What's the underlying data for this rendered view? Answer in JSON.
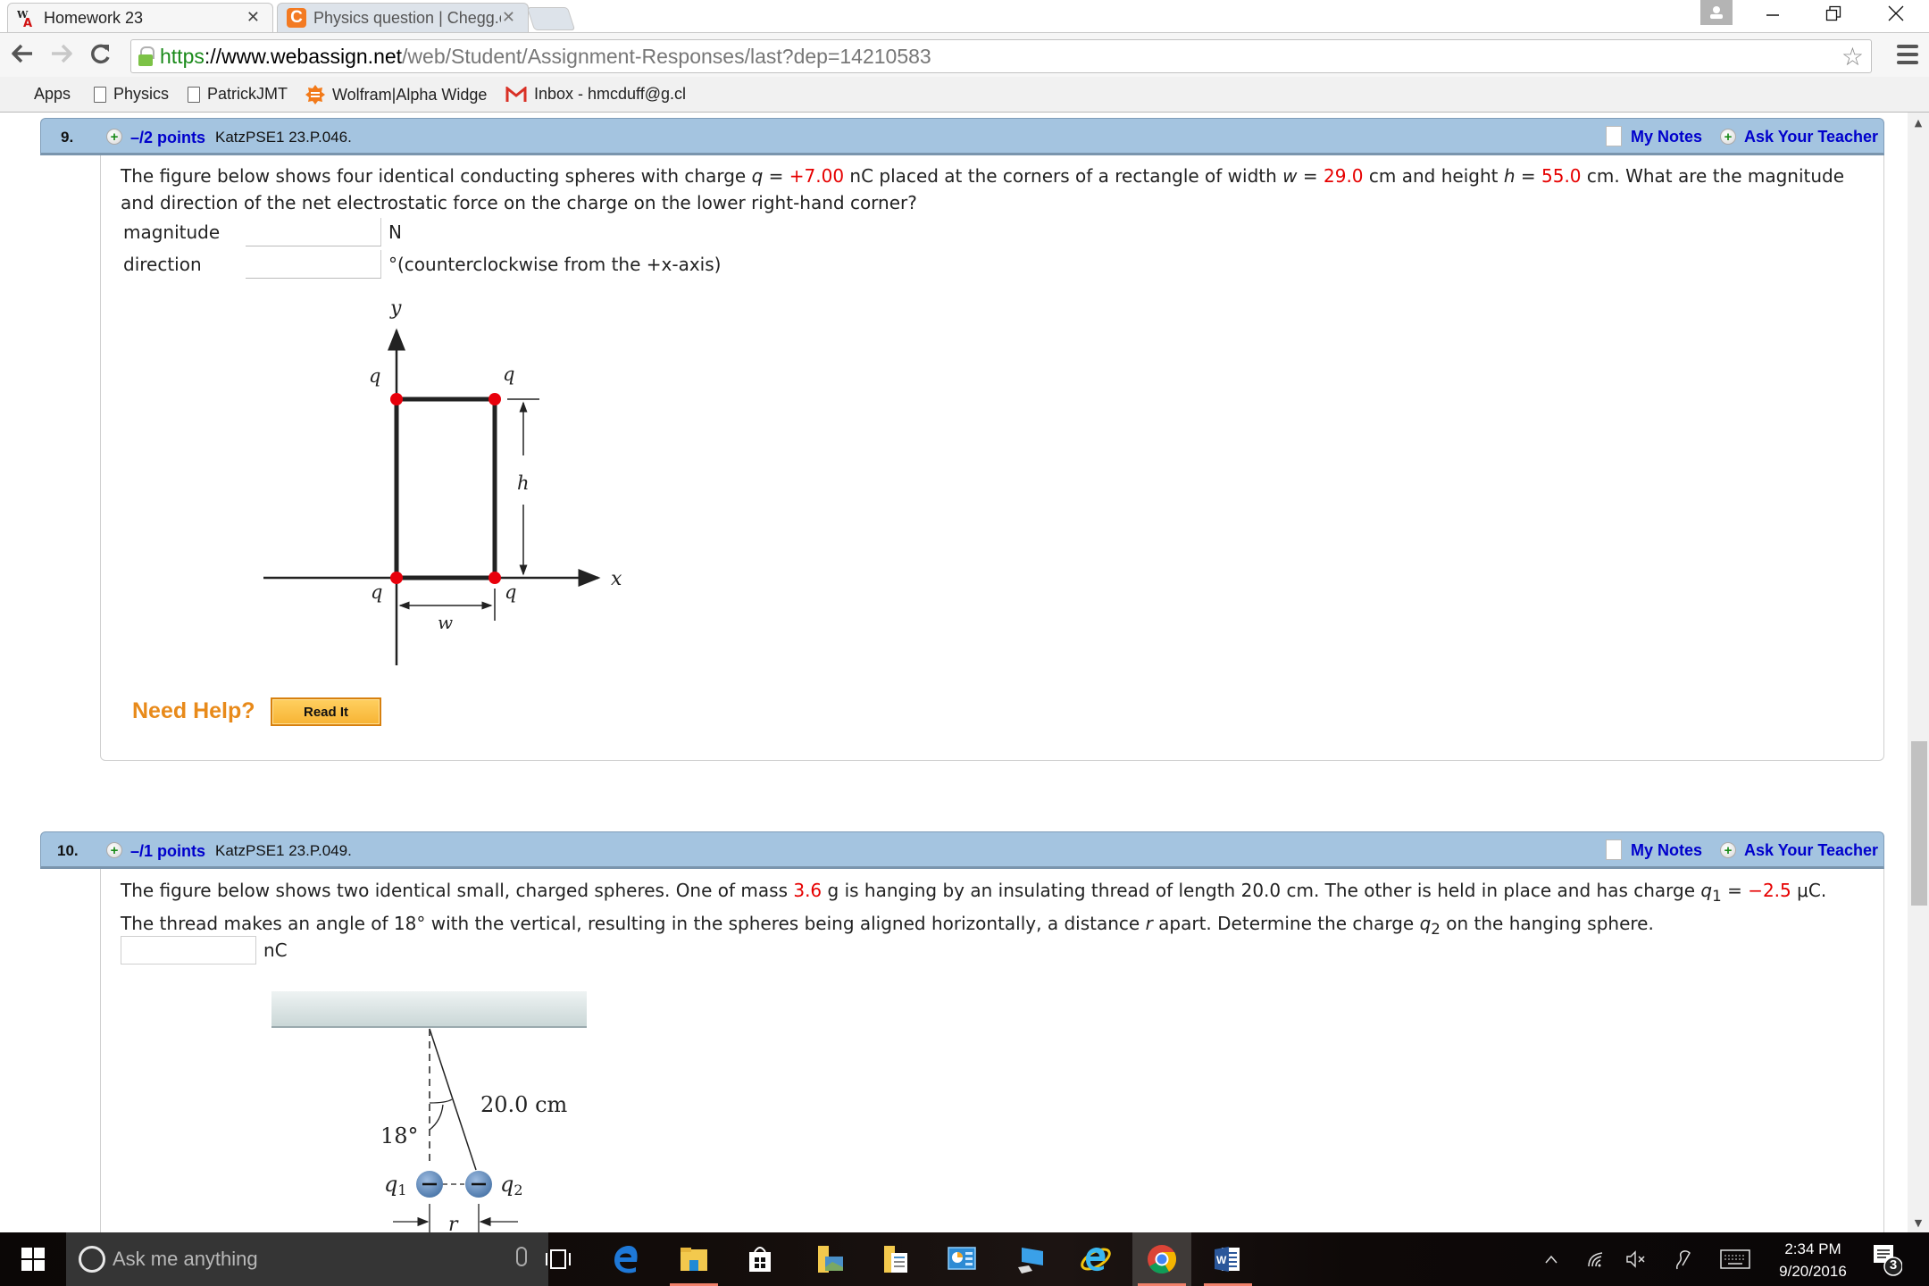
{
  "browser": {
    "tabs": [
      {
        "title": "Homework 23",
        "favicon": "webassign-icon",
        "active": true
      },
      {
        "title": "Physics question | Chegg.c",
        "favicon": "chegg-icon",
        "active": false
      }
    ],
    "url": {
      "scheme": "https",
      "host": "://www.webassign.net",
      "path": "/web/Student/Assignment-Responses/last?dep=14210583"
    },
    "bookmarks": [
      {
        "label": "Apps",
        "icon": "apps-grid-icon"
      },
      {
        "label": "Physics",
        "icon": "page-icon"
      },
      {
        "label": "PatrickJMT",
        "icon": "page-icon"
      },
      {
        "label": "Wolfram|Alpha Widge",
        "icon": "wolfram-icon"
      },
      {
        "label": "Inbox - hmcduff@g.cl",
        "icon": "gmail-icon"
      }
    ]
  },
  "questions": [
    {
      "number": "9.",
      "points": "–/2 points",
      "code": "KatzPSE1 23.P.046.",
      "my_notes": "My Notes",
      "ask_teacher": "Ask Your Teacher",
      "text": {
        "p1": "The figure below shows four identical conducting spheres with charge ",
        "q_sym": "q",
        "eq": " = ",
        "q_val": "+7.00",
        "p2": " nC  placed at the corners of a rectangle of width ",
        "w_sym": "w",
        "w_val": "29.0",
        "p3": " cm  and height ",
        "h_sym": "h",
        "h_val": "55.0",
        "p4": " cm.  What are the magnitude and direction of the net electrostatic force on the charge on the lower right-hand corner?"
      },
      "answers": [
        {
          "label": "magnitude",
          "value": "",
          "unit": "N"
        },
        {
          "label": "direction",
          "value": "",
          "unit": "°(counterclockwise from the +x-axis)"
        }
      ],
      "figure": {
        "axis_x": "x",
        "axis_y": "y",
        "charge_label": "q",
        "width_label": "w",
        "height_label": "h"
      },
      "need_help": "Need Help?",
      "read_it": "Read It"
    },
    {
      "number": "10.",
      "points": "–/1 points",
      "code": "KatzPSE1 23.P.049.",
      "my_notes": "My Notes",
      "ask_teacher": "Ask Your Teacher",
      "text": {
        "p1": "The figure below shows two identical small, charged spheres. One of mass ",
        "mass_val": "3.6",
        "p2": " g is hanging by an insulating thread of length 20.0 cm. The other is held in place and has charge ",
        "q1_sym": "q",
        "q1_sub": "1",
        "eq": " = ",
        "q1_val": "−2.5",
        "p3": " μC.  The thread makes an angle of 18° with the vertical, resulting in the spheres being aligned horizontally, a distance ",
        "r_sym": "r",
        "p4": " apart. Determine the charge ",
        "q2_sym": "q",
        "q2_sub": "2",
        "p5": " on the hanging sphere."
      },
      "answer": {
        "value": "",
        "unit": "nC"
      },
      "figure": {
        "length_label": "20.0 cm",
        "angle_label": "18°",
        "q1_label": "q",
        "q1_sub": "1",
        "q2_label": "q",
        "q2_sub": "2",
        "r_label": "r",
        "sphere_sign": "–"
      }
    }
  ],
  "taskbar": {
    "search_placeholder": "Ask me anything",
    "time": "2:34 PM",
    "date": "9/20/2016",
    "notification_count": "3",
    "pinned": [
      "task-view",
      "edge",
      "file-explorer",
      "store",
      "photos-folder",
      "documents-folder",
      "control-panel",
      "this-pc",
      "internet-explorer",
      "chrome",
      "word"
    ]
  }
}
